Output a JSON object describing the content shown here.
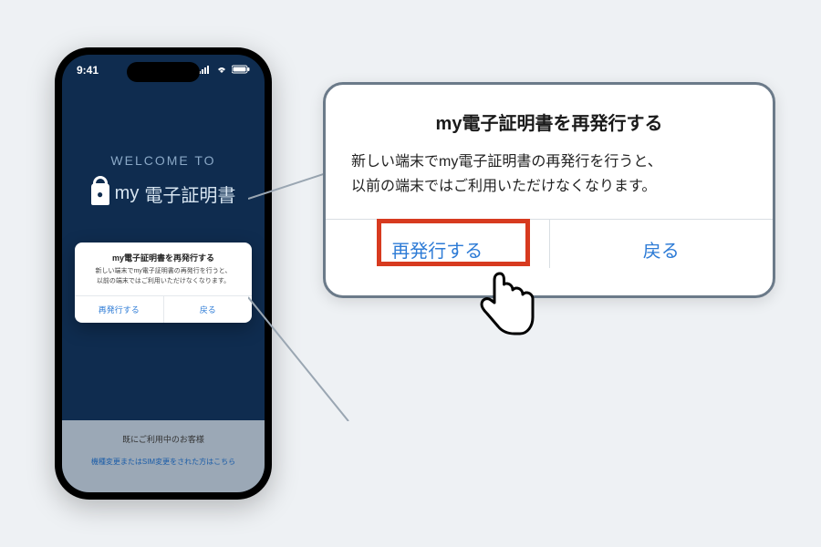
{
  "status": {
    "time": "9:41"
  },
  "welcome": "WELCOME TO",
  "brand": {
    "prefix": "my",
    "name": "電子証明書"
  },
  "dialog": {
    "title": "my電子証明書を再発行する",
    "body_line1": "新しい端末でmy電子証明書の再発行を行うと、",
    "body_line2": "以前の端末ではご利用いただけなくなります。",
    "reissue_label": "再発行する",
    "back_label": "戻る"
  },
  "footer": {
    "heading": "既にご利用中のお客様",
    "link": "機種変更またはSIM変更をされた方はこちら"
  },
  "colors": {
    "screen_bg": "#0f2c4f",
    "link_blue": "#2d7bd6",
    "highlight_red": "#d73a1f",
    "zoom_border": "#6b7a89"
  }
}
